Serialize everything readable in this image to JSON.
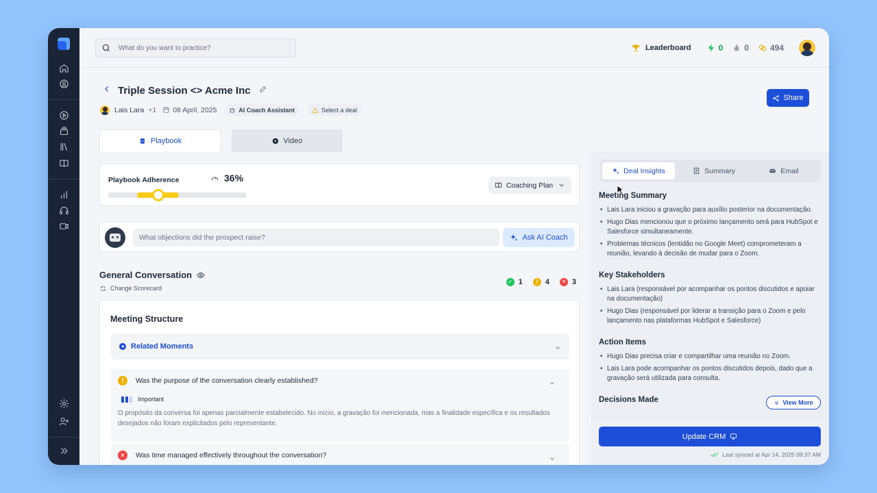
{
  "search": {
    "placeholder": "What do you want to practice?"
  },
  "topbar": {
    "leaderboard_label": "Leaderboard",
    "stats": {
      "energy": "0",
      "streak": "0",
      "coins": "494"
    }
  },
  "header": {
    "title": "Triple Session <> Acme Inc",
    "owner": "Lais Lara",
    "extra_participants": "+1",
    "date": "08 April, 2025",
    "assistant_chip": "AI Coach Assistant",
    "deal_chip": "Select a deal",
    "share_label": "Share"
  },
  "tabs": {
    "playbook": "Playbook",
    "video": "Video"
  },
  "adherence": {
    "label": "Playbook Adherence",
    "percent_text": "36%",
    "value": 0.36,
    "coaching_plan_label": "Coaching Plan"
  },
  "ask": {
    "placeholder": "What objections did the prospect raise?",
    "button": "Ask AI Coach"
  },
  "general": {
    "title": "General Conversation",
    "change_scorecard": "Change Scorecard",
    "counts": {
      "pass": "1",
      "warn": "4",
      "fail": "3"
    }
  },
  "meeting_structure": {
    "title": "Meeting Structure",
    "related_moments": "Related Moments",
    "questions": [
      {
        "text": "Was the purpose of the conversation clearly established?",
        "priority": "Important",
        "answer": "O propósito da conversa foi apenas parcialmente estabelecido. No início, a gravação foi mencionada, mas a finalidade específica e os resultados desejados não foram explicitados pelo representante."
      },
      {
        "text": "Was time managed effectively throughout the conversation?"
      }
    ]
  },
  "right_panel": {
    "tabs": {
      "deal_insights": "Deal Insights",
      "summary": "Summary",
      "email": "Email"
    },
    "sections": [
      {
        "title": "Meeting Summary",
        "items": [
          "Lais Lara iniciou a gravação para auxílio posterior na documentação.",
          "Hugo Dias mencionou que o próximo lançamento será para HubSpot e Salesforce simultaneamente.",
          "Problemas técnicos (lentidão no Google Meet) comprometeram a reunião, levando à decisão de mudar para o Zoom."
        ]
      },
      {
        "title": "Key Stakeholders",
        "items": [
          "Lais Lara (responsável por acompanhar os pontos discutidos e apoiar na documentação)",
          "Hugo Dias (responsável por liderar a transição para o Zoom e pelo lançamento nas plataformas HubSpot e Salesforce)"
        ]
      },
      {
        "title": "Action Items",
        "items": [
          "Hugo Dias precisa criar e compartilhar uma reunião no Zoom.",
          "Lais Lara pode acompanhar os pontos discutidos depois, dado que a gravação será utilizada para consulta."
        ]
      },
      {
        "title": "Decisions Made",
        "items": []
      }
    ],
    "view_more": "View More",
    "update_crm": "Update CRM",
    "last_synced": "Last synced at Apr 14, 2025 09:37 AM"
  },
  "colors": {
    "accent": "#1d4ed8",
    "sidebar": "#1b2336",
    "adherence": "#facc15",
    "pass": "#22c55e",
    "warn": "#eab308",
    "fail": "#ef4444"
  }
}
